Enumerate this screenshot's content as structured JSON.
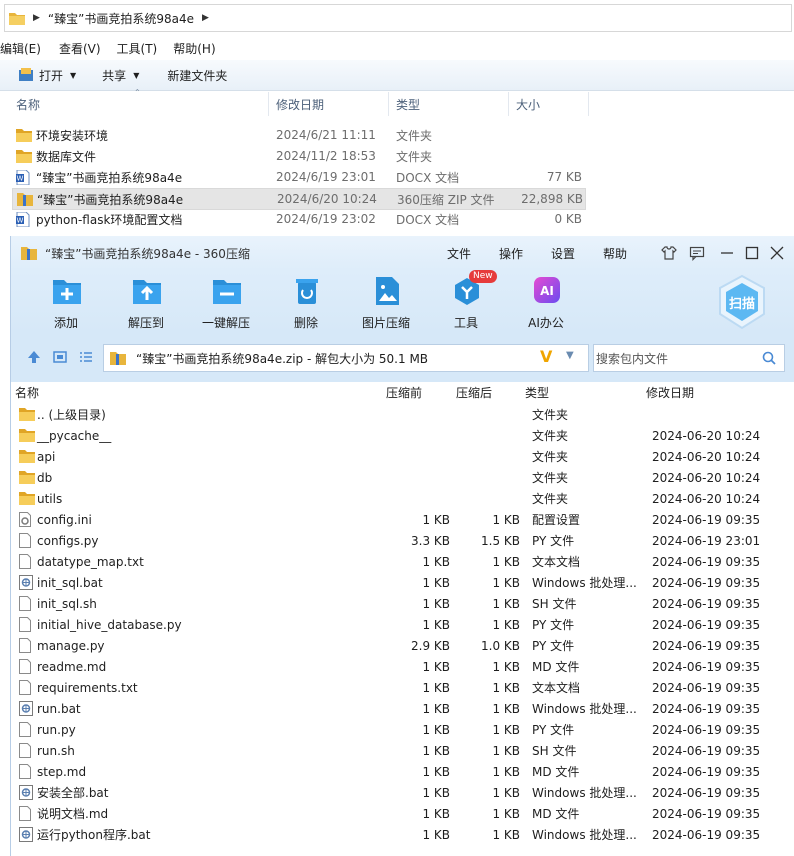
{
  "explorer": {
    "breadcrumb": "“臻宝”书画竞拍系统98a4e",
    "menu": [
      "编辑(E)",
      "查看(V)",
      "工具(T)",
      "帮助(H)"
    ],
    "toolbar": {
      "open": "打开",
      "share": "共享",
      "new_folder": "新建文件夹"
    },
    "columns": {
      "name": "名称",
      "date": "修改日期",
      "type": "类型",
      "size": "大小"
    },
    "files": [
      {
        "name": "环境安装环境",
        "date": "2024/6/21 11:11",
        "type": "文件夹",
        "size": "",
        "icon": "folder-icon"
      },
      {
        "name": "数据库文件",
        "date": "2024/11/2 18:53",
        "type": "文件夹",
        "size": "",
        "icon": "folder-icon"
      },
      {
        "name": "“臻宝”书画竞拍系统98a4e",
        "date": "2024/6/19 23:01",
        "type": "DOCX 文档",
        "size": "77 KB",
        "icon": "word-doc-icon"
      },
      {
        "name": "“臻宝”书画竞拍系统98a4e",
        "date": "2024/6/20 10:24",
        "type": "360压缩 ZIP 文件",
        "size": "22,898 KB",
        "icon": "zip-archive-icon",
        "selected": true
      },
      {
        "name": "python-flask环境配置文档",
        "date": "2024/6/19 23:02",
        "type": "DOCX 文档",
        "size": "0 KB",
        "icon": "word-doc-icon"
      }
    ]
  },
  "zip": {
    "title": "“臻宝”书画竞拍系统98a4e - 360压缩",
    "menu": [
      "文件",
      "操作",
      "设置",
      "帮助"
    ],
    "ribbon": [
      {
        "label": "添加",
        "icon": "add-icon"
      },
      {
        "label": "解压到",
        "icon": "extract-to-icon"
      },
      {
        "label": "一键解压",
        "icon": "one-click-extract-icon"
      },
      {
        "label": "删除",
        "icon": "delete-icon"
      },
      {
        "label": "图片压缩",
        "icon": "image-compress-icon"
      },
      {
        "label": "工具",
        "icon": "tools-icon"
      },
      {
        "label": "AI办公",
        "icon": "ai-office-icon"
      }
    ],
    "new_badge": "New",
    "scan_label": "扫描",
    "path_text": "“臻宝”书画竞拍系统98a4e.zip - 解包大小为 50.1 MB",
    "search_placeholder": "搜索包内文件",
    "columns": {
      "name": "名称",
      "before": "压缩前",
      "after": "压缩后",
      "type": "类型",
      "modified": "修改日期"
    },
    "entries": [
      {
        "name": ".. (上级目录)",
        "before": "",
        "after": "",
        "type": "文件夹",
        "modified": "",
        "icon": "folder-icon"
      },
      {
        "name": "__pycache__",
        "before": "",
        "after": "",
        "type": "文件夹",
        "modified": "2024-06-20 10:24",
        "icon": "folder-icon"
      },
      {
        "name": "api",
        "before": "",
        "after": "",
        "type": "文件夹",
        "modified": "2024-06-20 10:24",
        "icon": "folder-icon"
      },
      {
        "name": "db",
        "before": "",
        "after": "",
        "type": "文件夹",
        "modified": "2024-06-20 10:24",
        "icon": "folder-icon"
      },
      {
        "name": "utils",
        "before": "",
        "after": "",
        "type": "文件夹",
        "modified": "2024-06-20 10:24",
        "icon": "folder-icon"
      },
      {
        "name": "config.ini",
        "before": "1 KB",
        "after": "1 KB",
        "type": "配置设置",
        "modified": "2024-06-19 09:35",
        "icon": "settings-file-icon"
      },
      {
        "name": "configs.py",
        "before": "3.3 KB",
        "after": "1.5 KB",
        "type": "PY 文件",
        "modified": "2024-06-19 23:01",
        "icon": "file-icon"
      },
      {
        "name": "datatype_map.txt",
        "before": "1 KB",
        "after": "1 KB",
        "type": "文本文档",
        "modified": "2024-06-19 09:35",
        "icon": "file-icon"
      },
      {
        "name": "init_sql.bat",
        "before": "1 KB",
        "after": "1 KB",
        "type": "Windows 批处理...",
        "modified": "2024-06-19 09:35",
        "icon": "batch-file-icon"
      },
      {
        "name": "init_sql.sh",
        "before": "1 KB",
        "after": "1 KB",
        "type": "SH 文件",
        "modified": "2024-06-19 09:35",
        "icon": "file-icon"
      },
      {
        "name": "initial_hive_database.py",
        "before": "1 KB",
        "after": "1 KB",
        "type": "PY 文件",
        "modified": "2024-06-19 09:35",
        "icon": "file-icon"
      },
      {
        "name": "manage.py",
        "before": "2.9 KB",
        "after": "1.0 KB",
        "type": "PY 文件",
        "modified": "2024-06-19 09:35",
        "icon": "file-icon"
      },
      {
        "name": "readme.md",
        "before": "1 KB",
        "after": "1 KB",
        "type": "MD 文件",
        "modified": "2024-06-19 09:35",
        "icon": "file-icon"
      },
      {
        "name": "requirements.txt",
        "before": "1 KB",
        "after": "1 KB",
        "type": "文本文档",
        "modified": "2024-06-19 09:35",
        "icon": "file-icon"
      },
      {
        "name": "run.bat",
        "before": "1 KB",
        "after": "1 KB",
        "type": "Windows 批处理...",
        "modified": "2024-06-19 09:35",
        "icon": "batch-file-icon"
      },
      {
        "name": "run.py",
        "before": "1 KB",
        "after": "1 KB",
        "type": "PY 文件",
        "modified": "2024-06-19 09:35",
        "icon": "file-icon"
      },
      {
        "name": "run.sh",
        "before": "1 KB",
        "after": "1 KB",
        "type": "SH 文件",
        "modified": "2024-06-19 09:35",
        "icon": "file-icon"
      },
      {
        "name": "step.md",
        "before": "1 KB",
        "after": "1 KB",
        "type": "MD 文件",
        "modified": "2024-06-19 09:35",
        "icon": "file-icon"
      },
      {
        "name": "安装全部.bat",
        "before": "1 KB",
        "after": "1 KB",
        "type": "Windows 批处理...",
        "modified": "2024-06-19 09:35",
        "icon": "batch-file-icon"
      },
      {
        "name": "说明文档.md",
        "before": "1 KB",
        "after": "1 KB",
        "type": "MD 文件",
        "modified": "2024-06-19 09:35",
        "icon": "file-icon"
      },
      {
        "name": "运行python程序.bat",
        "before": "1 KB",
        "after": "1 KB",
        "type": "Windows 批处理...",
        "modified": "2024-06-19 09:35",
        "icon": "batch-file-icon"
      }
    ]
  },
  "colors": {
    "accent": "#2a8fd8",
    "ribbon": "#d6e8f8",
    "folder": "#e8b53c",
    "ai": "#8f4be6"
  }
}
